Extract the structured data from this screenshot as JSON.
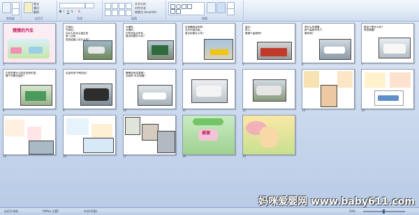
{
  "ribbon": {
    "groups": [
      "剪贴板",
      "幻灯片",
      "字体",
      "段落",
      "绘图"
    ],
    "new_slide": "新建\n幻灯片",
    "layout": "版式",
    "reset": "重设",
    "delete": "删除",
    "font_name": "",
    "font_size": "",
    "text_direction": "文字方向",
    "align_text": "对齐文本",
    "smartart": "转换为 SmartArt"
  },
  "slides": [
    {
      "num": "1",
      "title": "猜猜的汽车"
    },
    {
      "num": "2",
      "text": "它间出，\n它间出，\n为什么作天从诞生的\n来一边向...\n发到这路上见什么车？"
    },
    {
      "num": "3",
      "text": "大嘴车，\n大嘴车，\n它吃完后边开车，\n表示你是什么车？"
    },
    {
      "num": "4",
      "text": "垃圾桶到这车样，\n大大不装垃圾，\n表示你是什么车？"
    },
    {
      "num": "5",
      "text": "高大，\n好人，\n是哪个装修吧？"
    },
    {
      "num": "6",
      "text": "有什么车嗖着，\n那个装修车来了，\n警车吧？"
    },
    {
      "num": "7",
      "text": "那这个是什么车？\n有急救器？"
    },
    {
      "num": "8",
      "text": "它的车是什么的在没有车里，\n哪个开着去保护？"
    },
    {
      "num": "9",
      "text": "垃圾车有干吗的话？"
    },
    {
      "num": "10",
      "text": "警察还有这里做？\n动动你 可以知道？"
    },
    {
      "num": "11"
    },
    {
      "num": "12"
    },
    {
      "num": "13"
    },
    {
      "num": "14"
    },
    {
      "num": "15"
    },
    {
      "num": "16"
    },
    {
      "num": "17"
    },
    {
      "num": "18"
    },
    {
      "num": "19",
      "banner": "谢谢"
    },
    {
      "num": "20"
    }
  ],
  "status": {
    "view": "幻灯片浏览",
    "theme": "\"Office 主题\"",
    "language": "中文(中国)",
    "zoom": "54%"
  },
  "watermark": "妈咪爱婴网 www.baby611.com"
}
